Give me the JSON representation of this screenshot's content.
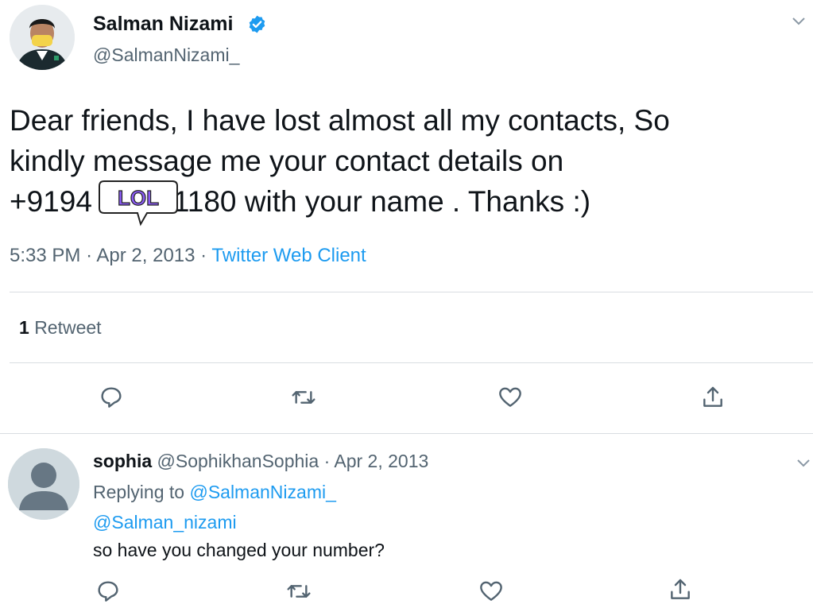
{
  "tweet": {
    "author_name": "Salman Nizami",
    "author_handle": "@SalmanNizami_",
    "text_lines": [
      "Dear friends, I have lost almost all my contacts, So",
      "kindly message me your contact details on",
      "+9194",
      "1180 with your name . Thanks :)"
    ],
    "time": "5:33 PM",
    "date": "Apr 2, 2013",
    "client": "Twitter Web Client",
    "separator": "·",
    "retweet_count": "1",
    "retweet_label": "Retweet",
    "sticker_text": "LOL"
  },
  "reply": {
    "author_name": "sophia",
    "author_handle": "@SophikhanSophia",
    "date": "Apr 2, 2013",
    "separator": "·",
    "replying_to_label": "Replying to",
    "replying_to_handle": "@SalmanNizami_",
    "mention": "@Salman_nizami",
    "text": "so have you changed your number?"
  },
  "icons": {
    "caret": "chevron-down-icon",
    "verified": "verified-badge-icon",
    "reply": "reply-icon",
    "retweet": "retweet-icon",
    "like": "heart-icon",
    "share": "share-icon"
  },
  "colors": {
    "accent": "#1d9bf0",
    "text": "#0f1419",
    "secondary": "#536471",
    "divider": "#d9dde1",
    "sticker_purple": "#8b5cf6"
  }
}
